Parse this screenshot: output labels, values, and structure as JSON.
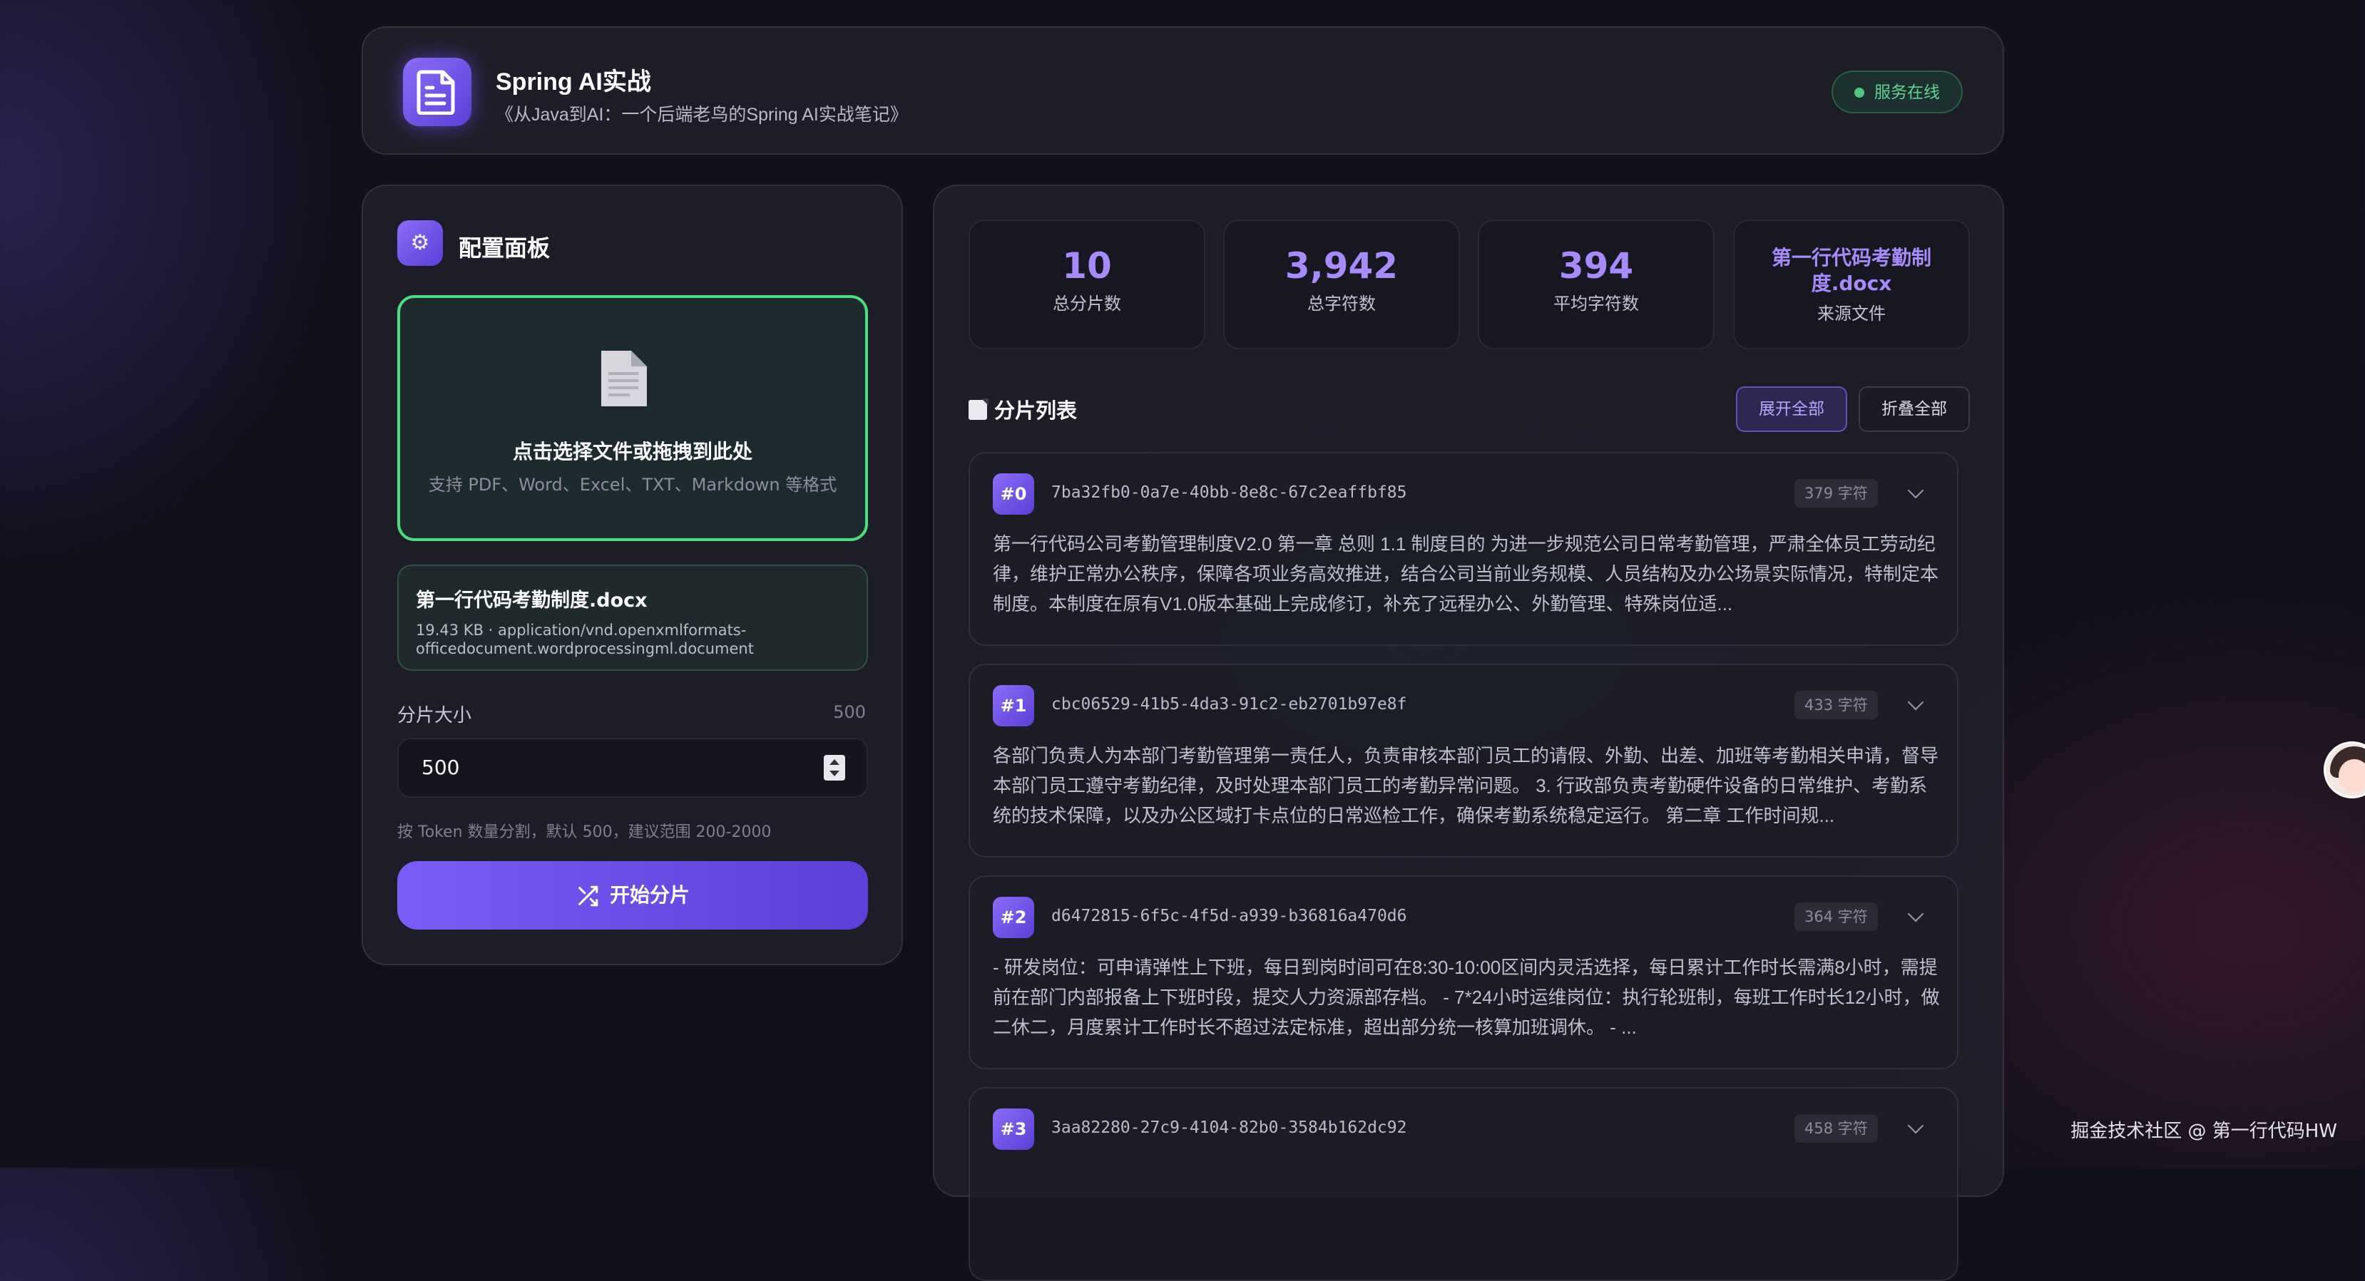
{
  "header": {
    "title": "Spring AI实战",
    "subtitle": "《从Java到AI：一个后端老鸟的Spring AI实战笔记》",
    "status": "服务在线"
  },
  "config": {
    "title": "配置面板",
    "icon": "gear-icon",
    "dropzone": {
      "title": "点击选择文件或拖拽到此处",
      "hint": "支持 PDF、Word、Excel、TXT、Markdown 等格式"
    },
    "file": {
      "name": "第一行代码考勤制度.docx",
      "meta": "19.43 KB · application/vnd.openxmlformats-officedocument.wordprocessingml.document"
    },
    "chunk_size_label": "分片大小",
    "chunk_size_display": "500",
    "chunk_size_input": "500",
    "chunk_size_hint": "按 Token 数量分割，默认 500，建议范围 200-2000",
    "start_button": "开始分片"
  },
  "stats": [
    {
      "value": "10",
      "label": "总分片数"
    },
    {
      "value": "3,942",
      "label": "总字符数"
    },
    {
      "value": "394",
      "label": "平均字符数"
    },
    {
      "value": "第一行代码考勤制度.docx",
      "label": "来源文件"
    }
  ],
  "list": {
    "title": "分片列表",
    "expand_all": "展开全部",
    "collapse_all": "折叠全部",
    "chunks": [
      {
        "index": "#0",
        "id": "7ba32fb0-0a7e-40bb-8e8c-67c2eaffbf85",
        "count": "379 字符",
        "text": "第一行代码公司考勤管理制度V2.0 第一章 总则 1.1 制度目的 为进一步规范公司日常考勤管理，严肃全体员工劳动纪律，维护正常办公秩序，保障各项业务高效推进，结合公司当前业务规模、人员结构及办公场景实际情况，特制定本制度。本制度在原有V1.0版本基础上完成修订，补充了远程办公、外勤管理、特殊岗位适..."
      },
      {
        "index": "#1",
        "id": "cbc06529-41b5-4da3-91c2-eb2701b97e8f",
        "count": "433 字符",
        "text": "各部门负责人为本部门考勤管理第一责任人，负责审核本部门员工的请假、外勤、出差、加班等考勤相关申请，督导本部门员工遵守考勤纪律，及时处理本部门员工的考勤异常问题。 3. 行政部负责考勤硬件设备的日常维护、考勤系统的技术保障，以及办公区域打卡点位的日常巡检工作，确保考勤系统稳定运行。 第二章 工作时间规..."
      },
      {
        "index": "#2",
        "id": "d6472815-6f5c-4f5d-a939-b36816a470d6",
        "count": "364 字符",
        "text": "- 研发岗位：可申请弹性上下班，每日到岗时间可在8:30-10:00区间内灵活选择，每日累计工作时长需满8小时，需提前在部门内部报备上下班时段，提交人力资源部存档。 - 7*24小时运维岗位：执行轮班制，每班工作时长12小时，做二休二，月度累计工作时长不超过法定标准，超出部分统一核算加班调休。 - ..."
      },
      {
        "index": "#3",
        "id": "3aa82280-27c9-4104-82b0-3584b162dc92",
        "count": "458 字符",
        "text": ""
      }
    ]
  },
  "watermark": "掘金技术社区 @ 第一行代码HW"
}
